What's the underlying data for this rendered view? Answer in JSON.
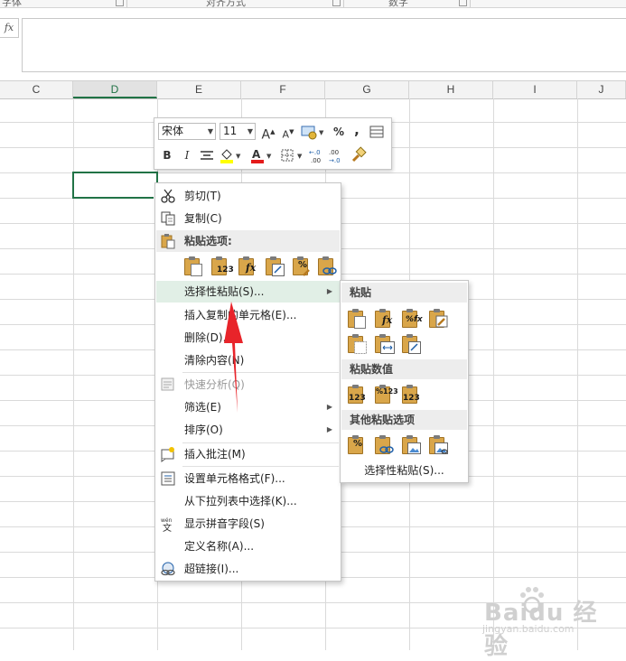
{
  "ribbon": {
    "groups": [
      "字体",
      "对齐方式",
      "数字"
    ]
  },
  "formula_bar": {
    "fx_label": "fx",
    "value": ""
  },
  "columns": [
    "C",
    "D",
    "E",
    "F",
    "G",
    "H",
    "I",
    "J"
  ],
  "active_column": "D",
  "mini_toolbar": {
    "font_name": "宋体",
    "font_size": "11",
    "bold_label": "B",
    "italic_label": "I",
    "percent_label": "%",
    "comma_label": ",",
    "font_color": "#e41b1b",
    "fill_color": "#ffff00"
  },
  "context_menu": {
    "items": [
      {
        "label": "剪切(T)",
        "icon": "scissors-icon"
      },
      {
        "label": "复制(C)",
        "icon": "copy-icon"
      },
      {
        "label": "粘贴选项:",
        "icon": "paste-icon"
      },
      {
        "label": "选择性粘贴(S)...",
        "icon": ""
      },
      {
        "label": "插入复制的单元格(E)...",
        "icon": ""
      },
      {
        "label": "删除(D)...",
        "icon": ""
      },
      {
        "label": "清除内容(N)",
        "icon": ""
      },
      {
        "label": "快速分析(Q)",
        "icon": "quick-analysis-icon"
      },
      {
        "label": "筛选(E)",
        "icon": ""
      },
      {
        "label": "排序(O)",
        "icon": ""
      },
      {
        "label": "插入批注(M)",
        "icon": "insert-comment-icon"
      },
      {
        "label": "设置单元格格式(F)...",
        "icon": "format-cells-icon"
      },
      {
        "label": "从下拉列表中选择(K)...",
        "icon": ""
      },
      {
        "label": "显示拼音字段(S)",
        "icon": "pinyin-icon"
      },
      {
        "label": "定义名称(A)...",
        "icon": ""
      },
      {
        "label": "超链接(I)...",
        "icon": "hyperlink-icon"
      }
    ],
    "paste_icon_tags": [
      "",
      "123",
      "fx",
      "",
      "%",
      ""
    ]
  },
  "paste_special_submenu": {
    "sections": [
      "粘贴",
      "粘贴数值",
      "其他粘贴选项"
    ],
    "paste_icon_tags": [
      "",
      "fx",
      "%fx",
      "",
      "",
      "",
      ""
    ],
    "value_icon_tags": [
      "123",
      "%123",
      "123"
    ],
    "other_icon_tags": [
      "%",
      "",
      "",
      ""
    ],
    "footer_label": "选择性粘贴(S)..."
  },
  "watermark": {
    "text": "Baidu 经验",
    "url": "jingyan.baidu.com"
  },
  "colors": {
    "accent": "#217346",
    "highlight": "#e1efe6",
    "annotation": "#e8242a"
  }
}
